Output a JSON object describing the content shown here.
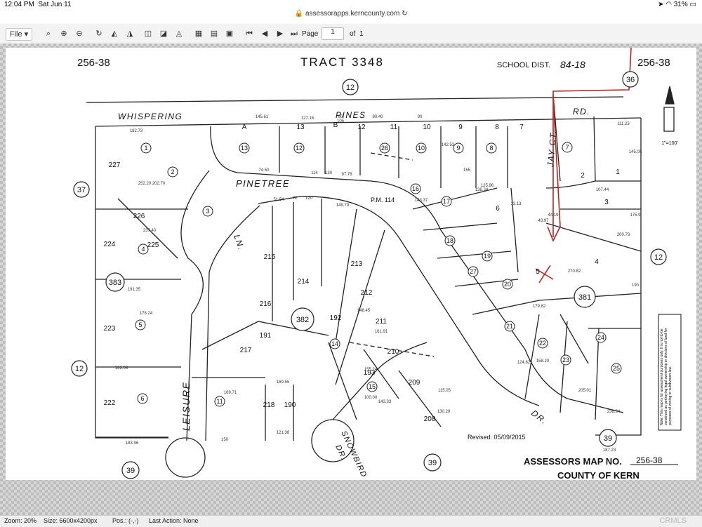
{
  "status": {
    "time": "12:04 PM",
    "date": "Sat Jun 11",
    "battery": "31%"
  },
  "browser": {
    "url": "assessorapps.kerncounty.com"
  },
  "toolbar": {
    "file_label": "File ▾",
    "page_label": "Page",
    "page_value": "1",
    "of_label": "of",
    "page_total": "1"
  },
  "map": {
    "header_left": "256-38",
    "header_title": "TRACT 3348",
    "school_label": "SCHOOL DIST.",
    "school_value": "84-18",
    "header_right": "256-38",
    "streets": {
      "whispering": "WHISPERING",
      "pines": "PINES",
      "rd": "RD.",
      "pinetree": "PINETREE",
      "ln": "LN.",
      "leisure": "LEISURE",
      "jay_ct": "JAY CT.",
      "dr": "DR.",
      "snowbird": "SNOWBIRD",
      "snowbird_dr": "DR.",
      "pm": "P.M. 114"
    },
    "circled": {
      "c12_top": "12",
      "c36": "36",
      "c37": "37",
      "c383": "383",
      "c382": "382",
      "c381": "381",
      "c12_right": "12",
      "c12_left": "12",
      "c39_left": "39",
      "c39_mid": "39",
      "c39_right": "39"
    },
    "lots": [
      "1",
      "2",
      "3",
      "4",
      "5",
      "6",
      "7",
      "8",
      "9",
      "10",
      "11",
      "12",
      "13",
      "14",
      "15",
      "16",
      "17",
      "18",
      "19",
      "20",
      "21",
      "22",
      "23",
      "24",
      "25",
      "26",
      "27"
    ],
    "plain_numbers": [
      "227",
      "226",
      "225",
      "224",
      "223",
      "222",
      "215",
      "214",
      "213",
      "212",
      "211",
      "210",
      "209",
      "208",
      "217",
      "216",
      "218",
      "190",
      "191",
      "192",
      "193",
      "1",
      "2",
      "3",
      "4",
      "5",
      "6",
      "7",
      "8",
      "9",
      "10",
      "11",
      "12",
      "13",
      "A",
      "B"
    ],
    "dims": [
      "182.73",
      "252.20",
      "202.70",
      "237.40",
      "191.35",
      "178.24",
      "169.71",
      "162.08",
      "183.96",
      "150",
      "121.38",
      "160.55",
      "143.33",
      "115.05",
      "130.29",
      "145.61",
      "127.16",
      "80",
      "105",
      "80.40",
      "90",
      "142.53",
      "155",
      "114",
      "130",
      "97.78",
      "74.50",
      "51.54",
      "72",
      "120",
      "149.79",
      "143.37",
      "138.34",
      "125.96",
      "107.44",
      "111.23",
      "145.05",
      "175.9",
      "200.78",
      "270.82",
      "179.82",
      "148.45",
      "161.91",
      "155.24",
      "100.00",
      "124.82",
      "158.20",
      "205.01",
      "236.24",
      "187.23",
      "190",
      "43.97",
      "44.19",
      "33.13"
    ],
    "revised": "Revised:  05/09/2015",
    "assessor_label": "ASSESSORS MAP NO.",
    "assessor_no": "256-38",
    "county": "COUNTY OF KERN",
    "note": "Note: This map is for assessment purposes only. It is not to be construed as portraying legal ownership or divisions of land for purposes of zoning or subdivision law.",
    "scale": "1\"=100'"
  },
  "footer": {
    "zoom": "Zoom: 20%",
    "size": "Size: 6600x4200px",
    "pos": "Pos.: (-,-)",
    "last_action": "Last Action: None"
  },
  "watermark": "CRMLS",
  "colors": {
    "annotation": "#c62020",
    "toolbar_bg": "#f3f3f3",
    "viewer_bg": "#d6d6d6"
  }
}
